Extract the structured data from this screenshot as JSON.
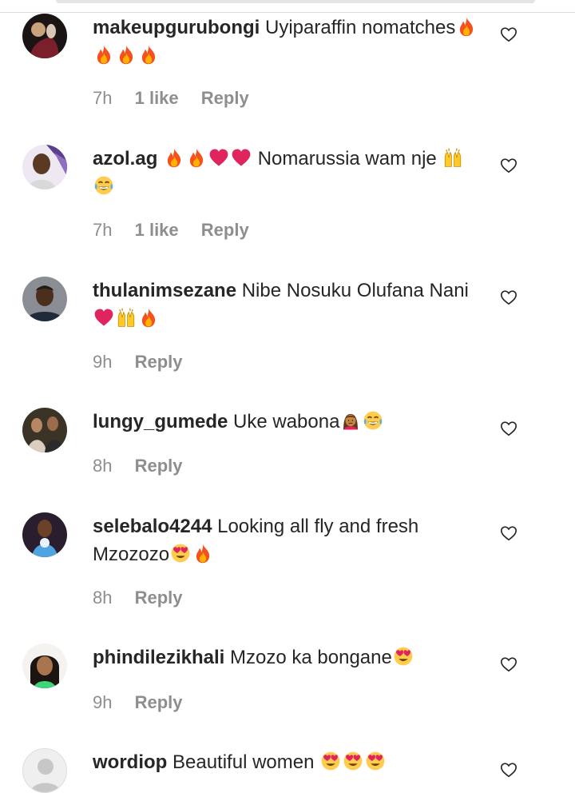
{
  "comments": [
    {
      "username": "makeupgurubongi",
      "text": "Uyiparaffin nomatches",
      "emojis_after": [
        "fire",
        "fire",
        "fire",
        "fire"
      ],
      "time": "7h",
      "likes": "1 like",
      "reply": "Reply"
    },
    {
      "username": "azol.ag",
      "text": "Nomarussia wam nje",
      "emojis_before": [
        "fire",
        "fire",
        "red-heart",
        "red-heart"
      ],
      "emojis_after": [
        "raising-hands",
        "tears-of-joy"
      ],
      "time": "7h",
      "likes": "1 like",
      "reply": "Reply"
    },
    {
      "username": "thulanimsezane",
      "text": "Nibe Nosuku Olufana Nani",
      "emojis_after": [
        "red-heart",
        "raising-hands",
        "fire"
      ],
      "time": "9h",
      "reply": "Reply"
    },
    {
      "username": "lungy_gumede",
      "text": "Uke wabona",
      "emojis_after": [
        "woman-frowning",
        "tears-of-joy"
      ],
      "time": "8h",
      "reply": "Reply"
    },
    {
      "username": "selebalo4244",
      "text": "Looking all fly and fresh Mzozozo",
      "emojis_after": [
        "heart-eyes",
        "fire"
      ],
      "time": "8h",
      "reply": "Reply"
    },
    {
      "username": "phindilezikhali",
      "text": "Mzozo ka bongane",
      "emojis_after": [
        "heart-eyes"
      ],
      "time": "9h",
      "reply": "Reply"
    },
    {
      "username": "wordiop",
      "text": "Beautiful women",
      "emojis_after": [
        "heart-eyes",
        "heart-eyes",
        "heart-eyes"
      ]
    }
  ],
  "colors": {
    "text": "#262626",
    "meta": "#8e8e8e",
    "divider": "#dbdbdb"
  }
}
